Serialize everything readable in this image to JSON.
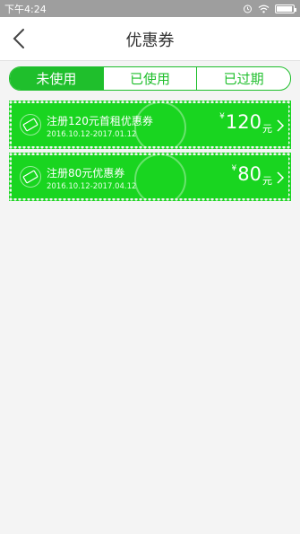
{
  "status_bar": {
    "time": "下午4:24"
  },
  "nav": {
    "title": "优惠券"
  },
  "tabs": [
    {
      "label": "未使用",
      "active": true
    },
    {
      "label": "已使用",
      "active": false
    },
    {
      "label": "已过期",
      "active": false
    }
  ],
  "coupons": [
    {
      "title": "注册120元首租优惠券",
      "date": "2016.10.12-2017.01.12",
      "currency": "¥",
      "amount": "120",
      "unit": "元"
    },
    {
      "title": "注册80元优惠券",
      "date": "2016.10.12-2017.04.12",
      "currency": "¥",
      "amount": "80",
      "unit": "元"
    }
  ],
  "colors": {
    "accent": "#1fbf2c",
    "coupon": "#19d520",
    "statusbar": "#9e9e9e"
  }
}
